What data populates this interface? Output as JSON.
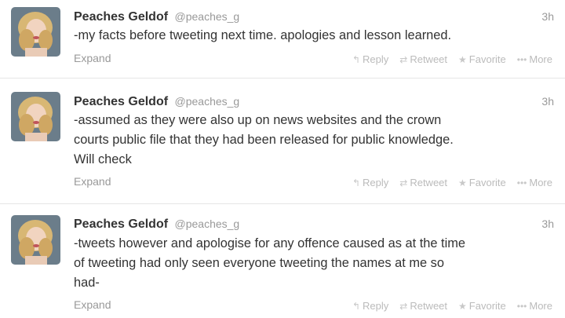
{
  "tweets": [
    {
      "name": "Peaches Geldof",
      "handle": "@peaches_g",
      "time": "3h",
      "lines": [
        "-my facts before tweeting next time. apologies and lesson learned."
      ],
      "expand": "Expand",
      "actions": {
        "reply": "Reply",
        "retweet": "Retweet",
        "favorite": "Favorite",
        "more": "More"
      }
    },
    {
      "name": "Peaches Geldof",
      "handle": "@peaches_g",
      "time": "3h",
      "lines": [
        "-assumed as they were also up on news websites and the crown",
        "courts public file that they had been released for public knowledge.",
        "Will check"
      ],
      "expand": "Expand",
      "actions": {
        "reply": "Reply",
        "retweet": "Retweet",
        "favorite": "Favorite",
        "more": "More"
      }
    },
    {
      "name": "Peaches Geldof",
      "handle": "@peaches_g",
      "time": "3h",
      "lines": [
        "-tweets however and apologise for any offence caused as at the time",
        "of tweeting had only seen everyone tweeting the names at me so",
        "had-"
      ],
      "expand": "Expand",
      "actions": {
        "reply": "Reply",
        "retweet": "Retweet",
        "favorite": "Favorite",
        "more": "More"
      }
    }
  ],
  "icons": {
    "reply": "reply-arrow-icon",
    "retweet": "retweet-icon",
    "favorite": "star-icon",
    "more": "more-dots-icon"
  }
}
